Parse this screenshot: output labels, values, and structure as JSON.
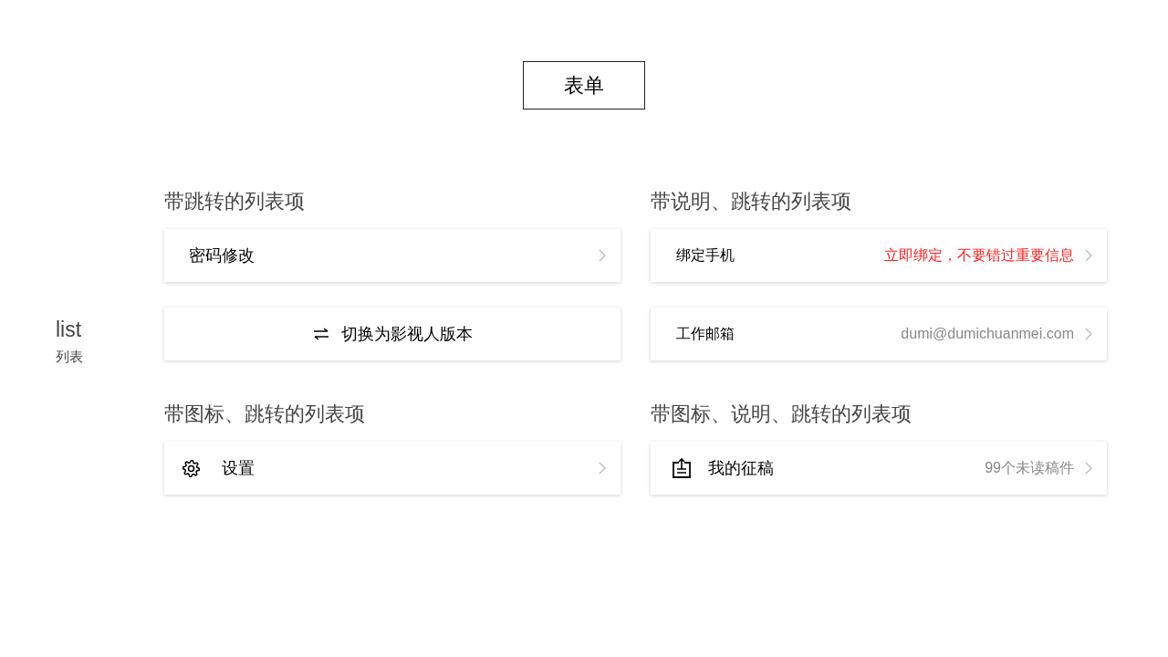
{
  "title": "表单",
  "side": {
    "title": "list",
    "subtitle": "列表"
  },
  "groups": [
    {
      "heading": "带跳转的列表项",
      "items": [
        {
          "kind": "plain",
          "label": "密码修改"
        },
        {
          "kind": "action",
          "label": "切换为影视人版本"
        }
      ]
    },
    {
      "heading": "带说明、跳转的列表项",
      "items": [
        {
          "kind": "note",
          "label": "绑定手机",
          "note": "立即绑定，不要错过重要信息",
          "color": "#ff1f1f"
        },
        {
          "kind": "note",
          "label": "工作邮箱",
          "note": "dumi@dumichuanmei.com",
          "color": "#888888"
        }
      ]
    },
    {
      "heading": "带图标、跳转的列表项",
      "items": [
        {
          "kind": "settings",
          "label": "设置"
        }
      ]
    },
    {
      "heading": "带图标、说明、跳转的列表项",
      "items": [
        {
          "kind": "submissions",
          "label": "我的征稿",
          "note": "99个未读稿件",
          "color": "#888888"
        }
      ]
    }
  ]
}
